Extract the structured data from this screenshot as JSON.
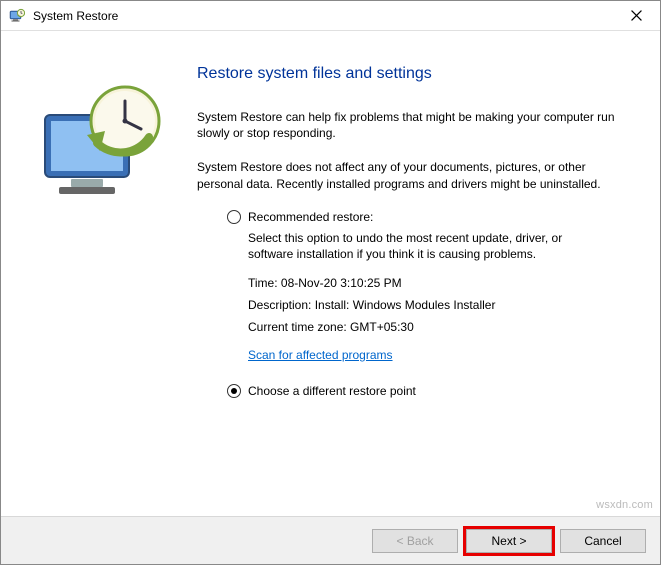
{
  "titlebar": {
    "title": "System Restore"
  },
  "heading": "Restore system files and settings",
  "para1": "System Restore can help fix problems that might be making your computer run slowly or stop responding.",
  "para2": "System Restore does not affect any of your documents, pictures, or other personal data. Recently installed programs and drivers might be uninstalled.",
  "options": {
    "recommended": {
      "label": "Recommended restore:",
      "desc": "Select this option to undo the most recent update, driver, or software installation if you think it is causing problems.",
      "time_label": "Time: ",
      "time_value": "08-Nov-20 3:10:25 PM",
      "desc2_label": "Description: ",
      "desc2_value": "Install: Windows Modules Installer",
      "tz_label": "Current time zone: ",
      "tz_value": "GMT+05:30",
      "scan_link": "Scan for affected programs"
    },
    "different": {
      "label": "Choose a different restore point"
    }
  },
  "footer": {
    "back": "< Back",
    "next": "Next >",
    "cancel": "Cancel"
  },
  "watermark": "wsxdn.com"
}
